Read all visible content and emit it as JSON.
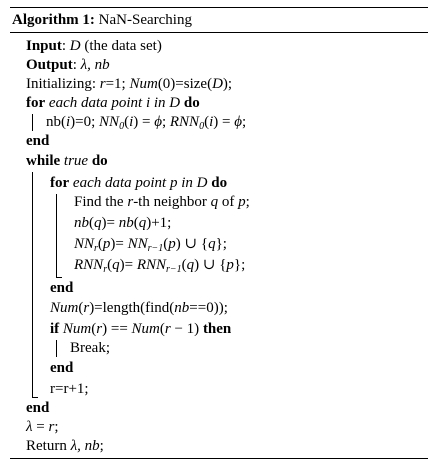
{
  "algorithm": {
    "caption_label": "Algorithm 1:",
    "caption_title": "NaN-Searching",
    "lines": {
      "input_kw": "Input",
      "input_text": ": D (the data set)",
      "output_kw": "Output",
      "output_text": ": λ, nb",
      "init": "Initializing: r=1; Num(0)=size(D);",
      "for1_kw": "for",
      "for1_text": " each data point i in D ",
      "do_kw": "do",
      "for1_body": "nb(i)=0; NN0(i) = ϕ; RNN0(i) = ϕ;",
      "end_kw": "end",
      "while_kw": "while",
      "while_text": " true ",
      "for2_text": " each data point p in D ",
      "find": "Find the r-th neighbor q of p;",
      "nbq": "nb(q)= nb(q)+1;",
      "nnr": "NNr(p)= NNr−1(p) ∪ {q};",
      "rnnr": "RNNr(q)= RNNr−1(q) ∪ {p};",
      "numr": "Num(r)=length(find(nb==0));",
      "if_kw": "if",
      "if_text": " Num(r) == Num(r − 1) ",
      "then_kw": "then",
      "break": "Break;",
      "rinc": "r=r+1;",
      "lambda": "λ = r;",
      "return": "Return λ, nb;"
    }
  }
}
